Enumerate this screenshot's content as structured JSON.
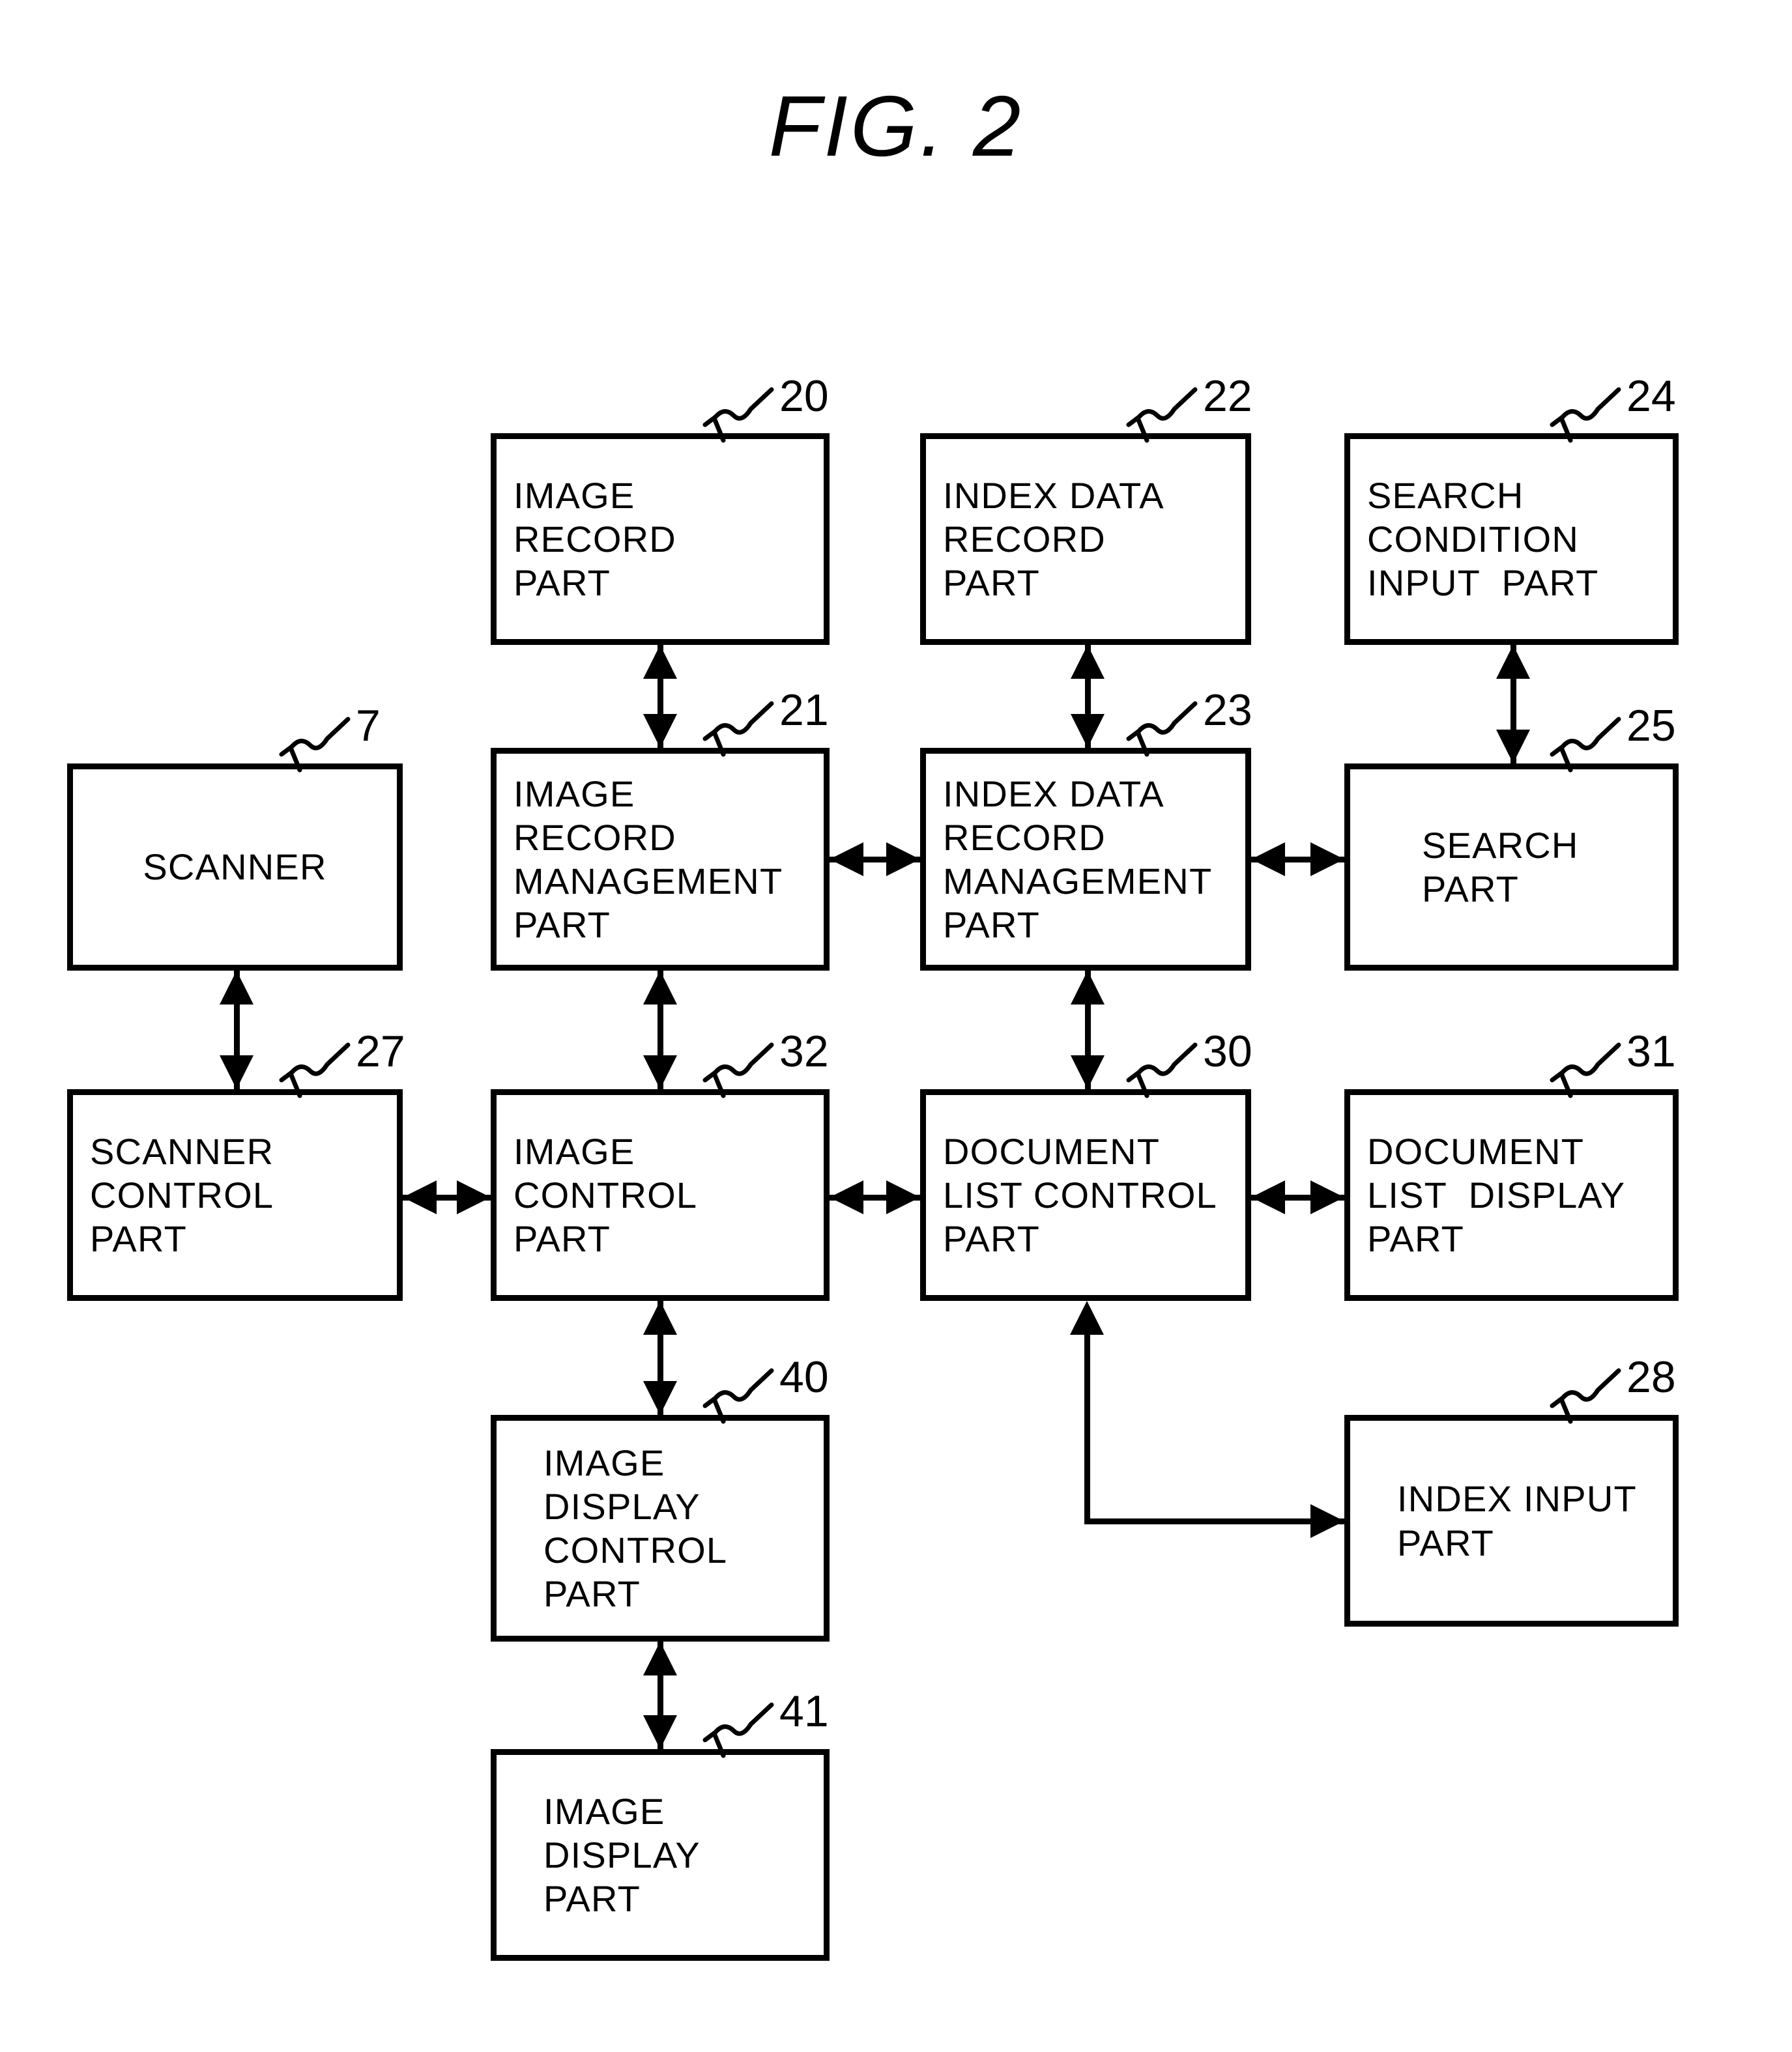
{
  "figure": {
    "title": "FIG.  2"
  },
  "nodes": [
    {
      "ref": "20",
      "lines": "IMAGE\nRECORD\nPART",
      "align": "left"
    },
    {
      "ref": "22",
      "lines": "INDEX DATA\nRECORD\nPART",
      "align": "left"
    },
    {
      "ref": "24",
      "lines": "SEARCH\nCONDITION\nINPUT  PART",
      "align": "left"
    },
    {
      "ref": "7",
      "lines": "SCANNER",
      "align": "center"
    },
    {
      "ref": "21",
      "lines": "IMAGE\nRECORD\nMANAGEMENT\nPART",
      "align": "left"
    },
    {
      "ref": "23",
      "lines": "INDEX DATA\nRECORD\nMANAGEMENT\nPART",
      "align": "left"
    },
    {
      "ref": "25",
      "lines": "SEARCH\nPART",
      "align": "pad1"
    },
    {
      "ref": "27",
      "lines": "SCANNER\nCONTROL\nPART",
      "align": "left"
    },
    {
      "ref": "32",
      "lines": "IMAGE\nCONTROL\nPART",
      "align": "left"
    },
    {
      "ref": "30",
      "lines": "DOCUMENT\nLIST CONTROL\nPART",
      "align": "left"
    },
    {
      "ref": "31",
      "lines": "DOCUMENT\nLIST  DISPLAY\nPART",
      "align": "left"
    },
    {
      "ref": "40",
      "lines": "IMAGE\nDISPLAY\nCONTROL\nPART",
      "align": "pad2"
    },
    {
      "ref": "28",
      "lines": "INDEX INPUT\nPART",
      "align": "pad2"
    },
    {
      "ref": "41",
      "lines": "IMAGE\nDISPLAY\nPART",
      "align": "pad2"
    }
  ],
  "connections": [
    {
      "from": "20",
      "to": "21",
      "kind": "bidirectional-vertical"
    },
    {
      "from": "22",
      "to": "23",
      "kind": "bidirectional-vertical"
    },
    {
      "from": "24",
      "to": "25",
      "kind": "bidirectional-vertical"
    },
    {
      "from": "7",
      "to": "27",
      "kind": "bidirectional-vertical"
    },
    {
      "from": "21",
      "to": "23",
      "kind": "bidirectional-horizontal"
    },
    {
      "from": "23",
      "to": "25",
      "kind": "bidirectional-horizontal"
    },
    {
      "from": "21",
      "to": "32",
      "kind": "bidirectional-vertical"
    },
    {
      "from": "23",
      "to": "30",
      "kind": "bidirectional-vertical"
    },
    {
      "from": "27",
      "to": "32",
      "kind": "bidirectional-horizontal"
    },
    {
      "from": "32",
      "to": "30",
      "kind": "bidirectional-horizontal"
    },
    {
      "from": "30",
      "to": "31",
      "kind": "bidirectional-horizontal"
    },
    {
      "from": "32",
      "to": "40",
      "kind": "bidirectional-vertical"
    },
    {
      "from": "40",
      "to": "41",
      "kind": "bidirectional-vertical"
    },
    {
      "from": "30",
      "to": "28",
      "kind": "elbow-two-way"
    }
  ],
  "colors": {
    "ink": "#000000",
    "paper": "#ffffff"
  }
}
